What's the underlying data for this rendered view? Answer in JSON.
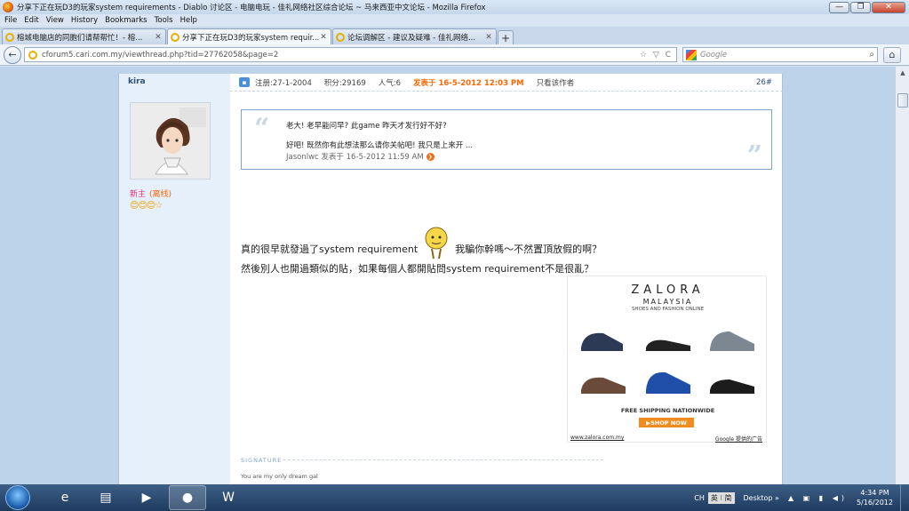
{
  "window": {
    "title": "分享下正在玩D3的玩家system requirements - Diablo 讨论区 - 电脑电玩 - 佳礼网络社区综合论坛 ~ 马来西亚中文论坛 - Mozilla Firefox",
    "min_label": "—",
    "max_label": "❐",
    "close_label": "✕"
  },
  "menu": [
    "File",
    "Edit",
    "View",
    "History",
    "Bookmarks",
    "Tools",
    "Help"
  ],
  "tabs": [
    {
      "label": "榕城电脑店的同胞们请帮帮忙！- 榕...",
      "close": "✕"
    },
    {
      "label": "分享下正在玩D3的玩家system requir...",
      "close": "✕"
    },
    {
      "label": "论坛调解区 - 建议及疑难 - 佳礼网络...",
      "close": "✕"
    }
  ],
  "new_tab": "+",
  "nav": {
    "url": "cforum5.cari.com.my/viewthread.php?tid=27762058&page=2",
    "url_ctrls": "☆ ▽ C",
    "search_placeholder": "Google",
    "search_icon": "⌕",
    "back_icon": "←",
    "home_icon": "⌂"
  },
  "post": {
    "author": "kira",
    "rank": "新主",
    "status": "(离线)",
    "stars": "😊😊😊☆",
    "header": {
      "user_icon": "▪",
      "registered": "注册:27-1-2004",
      "points": "积分:29169",
      "popularity": "人气:6",
      "posted": "发表于 16-5-2012 12:03 PM",
      "only_author": "只看该作者",
      "floor": "26#"
    },
    "quote": {
      "open_mark": "“",
      "close_mark": "”",
      "line1": "老大! 老早能问早? 此game 昨天才发行好不好?",
      "line2": "好吧! 既然你有此想法那么请你关帖吧! 我只是上来开 ...",
      "meta": "Jasonlwc 发表于 16-5-2012 11:59 AM",
      "go_icon": "❯"
    },
    "message_line1_a": "真的很早就發過了system requirement",
    "message_line1_b": "我騙你幹嗎～不然置頂放假的啊？",
    "message_line2": "然後別人也開過類似的貼，如果每個人都開貼問system requirement不是很亂？",
    "signature_label": "SIGNATURE",
    "signature_text": "You are my only dream gal"
  },
  "ad": {
    "brand": "ZALORA",
    "region": "MALAYSIA",
    "tagline": "SHOES AND FASHION ONLINE",
    "shipping": "FREE SHIPPING NATIONWIDE",
    "cta": "▶SHOP NOW",
    "url": "www.zalora.com.my",
    "provider": "Google 提供的广告"
  },
  "taskbar": {
    "apps": [
      {
        "name": "ie",
        "icon": "e"
      },
      {
        "name": "explorer",
        "icon": "▤"
      },
      {
        "name": "media",
        "icon": "▶"
      },
      {
        "name": "firefox",
        "icon": "●"
      },
      {
        "name": "word",
        "icon": "W"
      }
    ],
    "lang": "CH",
    "ime": "英 ⁝ 简",
    "desktop": "Desktop »",
    "tray_icons": "▲ ▣ ▮ ◀)",
    "time": "4:34 PM",
    "date": "5/16/2012"
  },
  "colors": {
    "page_bg": "#bcd3ea",
    "post_left_bg": "#e5f0fb",
    "accent_orange": "#ff6600",
    "link_blue": "#2f4f7a",
    "shop_button": "#f28c1e"
  }
}
